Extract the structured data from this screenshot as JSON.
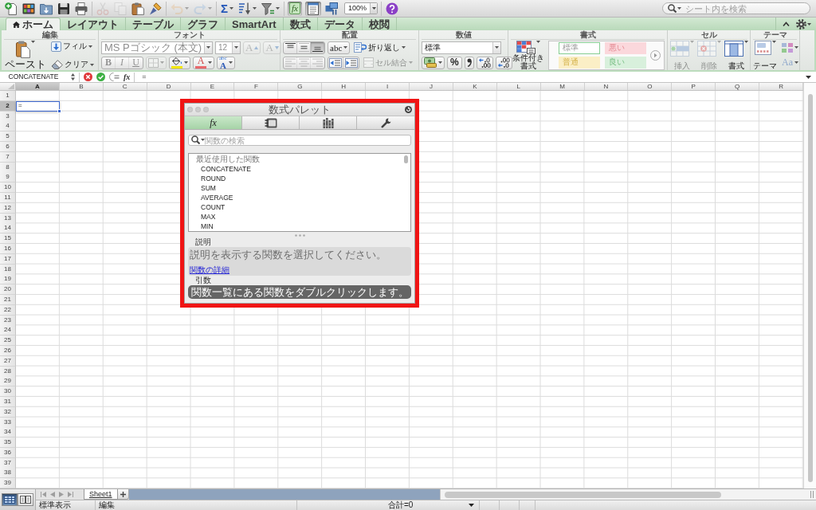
{
  "toolbar": {
    "groups": [
      {
        "buttons": [
          {
            "kind": "new-document",
            "disabled": false,
            "pressed": false
          },
          {
            "kind": "gallery",
            "disabled": false,
            "pressed": false
          },
          {
            "kind": "open",
            "disabled": false,
            "pressed": false
          },
          {
            "kind": "save",
            "disabled": false,
            "pressed": false
          },
          {
            "kind": "print",
            "disabled": false,
            "pressed": false
          }
        ]
      },
      {
        "buttons": [
          {
            "kind": "cut",
            "disabled": true,
            "pressed": false
          },
          {
            "kind": "copy",
            "disabled": true,
            "pressed": false
          },
          {
            "kind": "paste",
            "disabled": false,
            "pressed": false
          },
          {
            "kind": "format-painter",
            "disabled": false,
            "pressed": false
          }
        ]
      },
      {
        "buttons": [
          {
            "kind": "undo",
            "disabled": true,
            "pressed": false
          },
          {
            "kind": "redo",
            "disabled": true,
            "pressed": false
          }
        ]
      },
      {
        "buttons": [
          {
            "kind": "autosum",
            "label": "Σ",
            "disabled": false,
            "pressed": false
          },
          {
            "kind": "sort",
            "disabled": false,
            "pressed": false
          },
          {
            "kind": "filter",
            "disabled": false,
            "pressed": false
          }
        ]
      },
      {
        "buttons": [
          {
            "kind": "formula-builder",
            "label": "fx",
            "disabled": false,
            "pressed": true
          },
          {
            "kind": "toolbox",
            "disabled": false,
            "pressed": true
          },
          {
            "kind": "media",
            "disabled": false,
            "pressed": false
          }
        ],
        "zoom": {
          "value": "100%"
        }
      },
      {
        "buttons": [
          {
            "kind": "help",
            "disabled": false,
            "pressed": false
          }
        ]
      }
    ],
    "search": {
      "placeholder": "シート内を検索"
    }
  },
  "ribbon_tabs": [
    {
      "kind": "home",
      "label": "ホーム",
      "selected": true
    },
    {
      "kind": "text",
      "label": "レイアウト",
      "selected": false
    },
    {
      "kind": "text",
      "label": "テーブル",
      "selected": false
    },
    {
      "kind": "text",
      "label": "グラフ",
      "selected": false
    },
    {
      "kind": "text",
      "label": "SmartArt",
      "selected": false
    },
    {
      "kind": "text",
      "label": "数式",
      "selected": false
    },
    {
      "kind": "text",
      "label": "データ",
      "selected": false
    },
    {
      "kind": "text",
      "label": "校閲",
      "selected": false
    }
  ],
  "ribbon": {
    "groups": [
      {
        "kind": "edit",
        "title": "編集",
        "paste": {
          "label": "ペースト"
        },
        "buttons": [
          {
            "kind": "fill",
            "label": "フィル"
          },
          {
            "kind": "clear",
            "label": "クリア"
          }
        ]
      },
      {
        "kind": "font",
        "title": "フォント",
        "font_name": {
          "value": "MS Pゴシック (本文)",
          "disabled": true
        },
        "font_size": {
          "value": "12",
          "disabled": true
        },
        "size_buttons": [
          {
            "kind": "grow",
            "label": "A",
            "disabled": true
          },
          {
            "kind": "shrink",
            "label": "A",
            "disabled": true
          }
        ],
        "style_buttons": [
          {
            "kind": "bold",
            "label": "B",
            "disabled": true
          },
          {
            "kind": "italic",
            "label": "I",
            "disabled": true
          },
          {
            "kind": "underline",
            "label": "U",
            "disabled": true
          }
        ],
        "borders": {
          "disabled": true
        },
        "fill_color": {
          "color": "#f2e600"
        },
        "font_color": {
          "label": "A",
          "color": "#e8676b"
        },
        "text_effects": {
          "label_small": "abc",
          "label": "A"
        }
      },
      {
        "kind": "alignment",
        "title": "配置",
        "vertical": [
          {
            "kind": "top",
            "selected": false
          },
          {
            "kind": "middle",
            "selected": false
          },
          {
            "kind": "bottom",
            "selected": true
          }
        ],
        "orientation": {
          "label": "abc"
        },
        "wrap": {
          "label": "折り返し"
        },
        "horizontal": [
          {
            "kind": "left",
            "selected": false,
            "disabled": true
          },
          {
            "kind": "center",
            "selected": false,
            "disabled": true
          },
          {
            "kind": "right",
            "selected": false,
            "disabled": true
          }
        ],
        "indent": [
          {
            "kind": "decrease"
          },
          {
            "kind": "increase"
          }
        ],
        "merge": {
          "label": "セル結合",
          "disabled": true
        }
      },
      {
        "kind": "number",
        "title": "数値",
        "format": {
          "value": "標準"
        },
        "buttons": [
          {
            "kind": "currency"
          },
          {
            "kind": "percent",
            "label": "%"
          },
          {
            "kind": "comma"
          },
          {
            "kind": "increase-decimal"
          },
          {
            "kind": "decrease-decimal"
          }
        ]
      },
      {
        "kind": "styles",
        "title": "書式",
        "conditional": {
          "label": "条件付き書式"
        },
        "styles": [
          {
            "kind": "normal",
            "label": "標準",
            "selected": true
          },
          {
            "kind": "bad",
            "label": "悪い",
            "selected": false
          },
          {
            "kind": "neutral",
            "label": "普通",
            "selected": false
          },
          {
            "kind": "good",
            "label": "良い",
            "selected": false
          }
        ]
      },
      {
        "kind": "cells",
        "title": "セル",
        "buttons": [
          {
            "kind": "insert",
            "label": "挿入",
            "disabled": true
          },
          {
            "kind": "delete",
            "label": "削除",
            "disabled": true
          },
          {
            "kind": "format",
            "label": "書式",
            "disabled": false
          }
        ]
      },
      {
        "kind": "themes",
        "title": "テーマ",
        "themes": {
          "label": "テーマ"
        },
        "fonts": {
          "label": "Aa"
        }
      }
    ]
  },
  "formula_bar": {
    "name_box": {
      "value": "CONCATENATE"
    },
    "function_label": "fx",
    "formula": {
      "value": "="
    }
  },
  "sheet": {
    "columns": [
      {
        "label": "A",
        "selected": true
      },
      {
        "label": "B",
        "selected": false
      },
      {
        "label": "C",
        "selected": false
      },
      {
        "label": "D",
        "selected": false
      },
      {
        "label": "E",
        "selected": false
      },
      {
        "label": "F",
        "selected": false
      },
      {
        "label": "G",
        "selected": false
      },
      {
        "label": "H",
        "selected": false
      },
      {
        "label": "I",
        "selected": false
      },
      {
        "label": "J",
        "selected": false
      },
      {
        "label": "K",
        "selected": false
      },
      {
        "label": "L",
        "selected": false
      },
      {
        "label": "M",
        "selected": false
      },
      {
        "label": "N",
        "selected": false
      },
      {
        "label": "O",
        "selected": false
      },
      {
        "label": "P",
        "selected": false
      },
      {
        "label": "Q",
        "selected": false
      },
      {
        "label": "R",
        "selected": false
      }
    ],
    "rows": [
      {
        "label": "1",
        "selected": false
      },
      {
        "label": "2",
        "selected": true,
        "cells": [
          {
            "value": "=",
            "selected": true
          }
        ]
      },
      {
        "label": "3",
        "selected": false
      },
      {
        "label": "4",
        "selected": false
      },
      {
        "label": "5",
        "selected": false
      },
      {
        "label": "6",
        "selected": false
      },
      {
        "label": "7",
        "selected": false
      },
      {
        "label": "8",
        "selected": false
      },
      {
        "label": "9",
        "selected": false
      },
      {
        "label": "10",
        "selected": false
      },
      {
        "label": "11",
        "selected": false
      },
      {
        "label": "12",
        "selected": false
      },
      {
        "label": "13",
        "selected": false
      },
      {
        "label": "14",
        "selected": false
      },
      {
        "label": "15",
        "selected": false
      },
      {
        "label": "16",
        "selected": false
      },
      {
        "label": "17",
        "selected": false
      },
      {
        "label": "18",
        "selected": false
      },
      {
        "label": "19",
        "selected": false
      },
      {
        "label": "20",
        "selected": false
      },
      {
        "label": "21",
        "selected": false
      },
      {
        "label": "22",
        "selected": false
      },
      {
        "label": "23",
        "selected": false
      },
      {
        "label": "24",
        "selected": false
      },
      {
        "label": "25",
        "selected": false
      },
      {
        "label": "26",
        "selected": false
      },
      {
        "label": "27",
        "selected": false
      },
      {
        "label": "28",
        "selected": false
      },
      {
        "label": "29",
        "selected": false
      },
      {
        "label": "30",
        "selected": false
      },
      {
        "label": "31",
        "selected": false
      },
      {
        "label": "32",
        "selected": false
      },
      {
        "label": "33",
        "selected": false
      },
      {
        "label": "34",
        "selected": false
      },
      {
        "label": "35",
        "selected": false
      },
      {
        "label": "36",
        "selected": false
      },
      {
        "label": "37",
        "selected": false
      },
      {
        "label": "38",
        "selected": false
      },
      {
        "label": "39",
        "selected": false
      }
    ]
  },
  "formula_palette": {
    "title": "数式パレット",
    "tabs": [
      {
        "kind": "functions",
        "label": "fx",
        "selected": true
      },
      {
        "kind": "reference",
        "selected": false
      },
      {
        "kind": "library",
        "selected": false
      },
      {
        "kind": "tools",
        "selected": false
      }
    ],
    "search": {
      "placeholder": "関数の検索"
    },
    "function_list": {
      "heading": "最近使用した関数",
      "items": [
        {
          "label": "CONCATENATE",
          "selected": false
        },
        {
          "label": "ROUND",
          "selected": false
        },
        {
          "label": "SUM",
          "selected": false
        },
        {
          "label": "AVERAGE",
          "selected": false
        },
        {
          "label": "COUNT",
          "selected": false
        },
        {
          "label": "MAX",
          "selected": false
        },
        {
          "label": "MIN",
          "selected": false
        }
      ]
    },
    "description": {
      "heading": "説明",
      "text": "説明を表示する関数を選択してください。",
      "link": "関数の詳細"
    },
    "arguments": {
      "heading": "引数",
      "message": "関数一覧にある関数をダブルクリックします。"
    }
  },
  "view_buttons": [
    {
      "kind": "normal",
      "selected": true
    },
    {
      "kind": "page-layout",
      "selected": false
    }
  ],
  "sheet_tabs": {
    "tabs": [
      {
        "label": "Sheet1",
        "selected": true
      }
    ]
  },
  "status_bar": {
    "view": "標準表示",
    "mode": "編集",
    "sum": "合計=0"
  }
}
